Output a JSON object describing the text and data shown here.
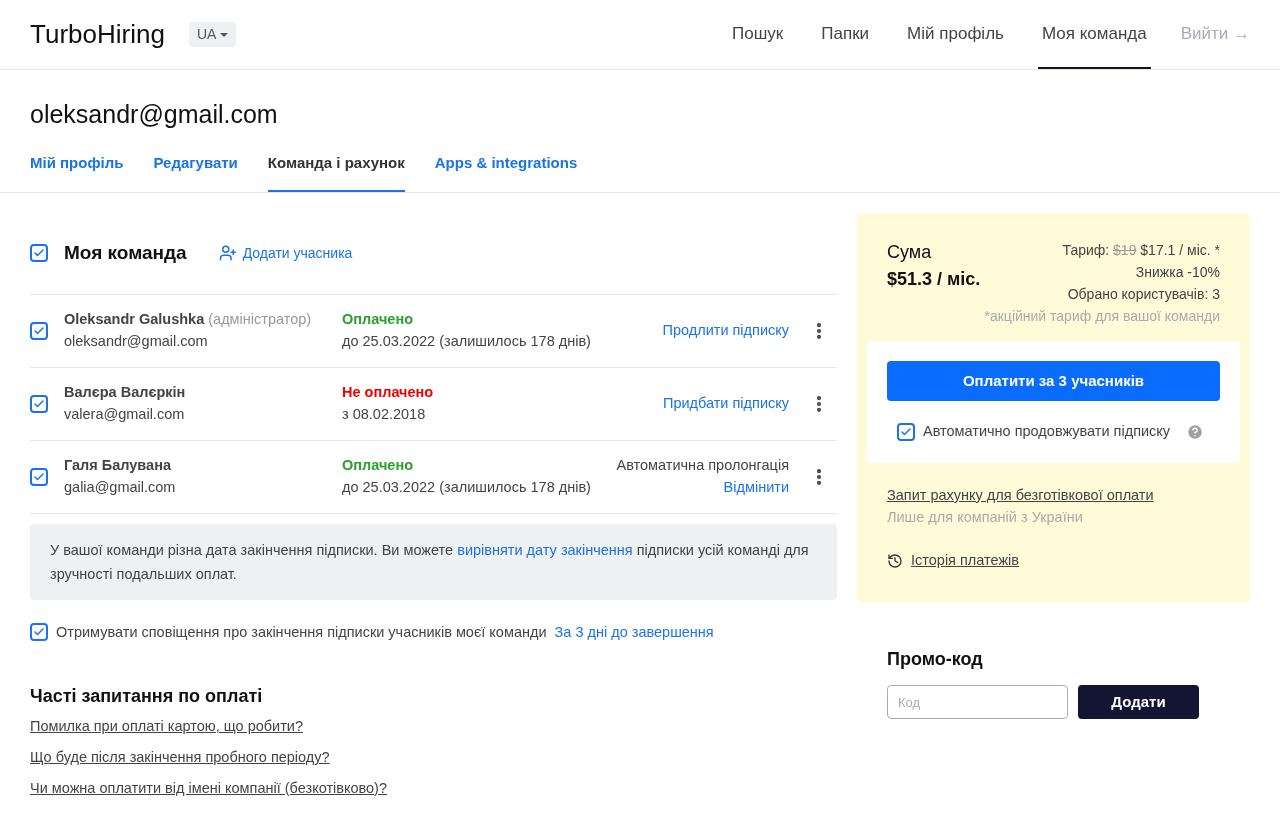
{
  "header": {
    "logo": "TurboHiring",
    "language": "UA",
    "nav": [
      {
        "label": "Пошук",
        "selected": false
      },
      {
        "label": "Папки",
        "selected": false
      },
      {
        "label": "Мій профіль",
        "selected": false
      },
      {
        "label": "Моя команда",
        "selected": true
      }
    ],
    "logout": "Вийти →"
  },
  "profile": {
    "email": "oleksandr@gmail.com",
    "tabs": [
      {
        "label": "Мій профіль",
        "selected": false
      },
      {
        "label": "Редагувати",
        "selected": false
      },
      {
        "label": "Команда і рахунок",
        "selected": true
      },
      {
        "label": "Apps & integrations",
        "selected": false
      }
    ]
  },
  "team": {
    "checked": true,
    "title": "Моя команда",
    "add_member": "Додати учасника",
    "members": [
      {
        "checked": true,
        "name": "Oleksandr Galushka",
        "role": "(адміністратор)",
        "email": "oleksandr@gmail.com",
        "status": "Оплачено",
        "paid": true,
        "date": "до 25.03.2022 (залишилось 178 днів)",
        "kind": "link",
        "action": "Продлити підписку"
      },
      {
        "checked": true,
        "name": "Валєра Валєркін",
        "email": "valera@gmail.com",
        "status": "Не оплачено",
        "paid": false,
        "date": "з 08.02.2018",
        "kind": "link",
        "action": "Придбати підписку"
      },
      {
        "checked": true,
        "name": "Галя Балувана",
        "email": "galia@gmail.com",
        "status": "Оплачено",
        "paid": true,
        "date": "до 25.03.2022 (залишилось 178 днів)",
        "kind": "auto",
        "action": "Автоматична пролонгація",
        "cancel": "Відмінити"
      }
    ],
    "notice": {
      "before": "У вашої команди різна дата закінчення підписки. Ви можете ",
      "link": "вирівняти дату закінчення",
      "after": " підписки усій команді для зручності подальших оплат."
    },
    "notify": {
      "checked": true,
      "text": "Отримувати сповіщення про закінчення підписки учасників моєї команди",
      "link": "За 3 дні до завершення"
    }
  },
  "faq": {
    "title": "Часті запитання по оплаті",
    "links": [
      "Помилка при оплаті картою, що робити?",
      "Що буде після закінчення пробного періоду?",
      "Чи можна оплатити від імені компанії (безкотівково)?"
    ]
  },
  "summary": {
    "sum_label": "Сума",
    "sum": "$51.3 / міс.",
    "tariff_label": "Тариф:",
    "old_price": "$19",
    "new_price": "$17.1 / міс. *",
    "discount": "Знижка -10%",
    "users": "Обрано користувачів: 3",
    "promo_note": "*акційний тариф для вашої команди",
    "pay_button": "Оплатити за 3 учасників",
    "auto_renew": {
      "checked": true,
      "label": "Автоматично продовжувати підписку"
    },
    "invoice_link": "Запит рахунку для безготівкової оплати",
    "invoice_note": "Лише для компаній з України",
    "history": "Історія платежів"
  },
  "promo": {
    "title": "Промо-код",
    "placeholder": "Код",
    "button": "Додати"
  }
}
